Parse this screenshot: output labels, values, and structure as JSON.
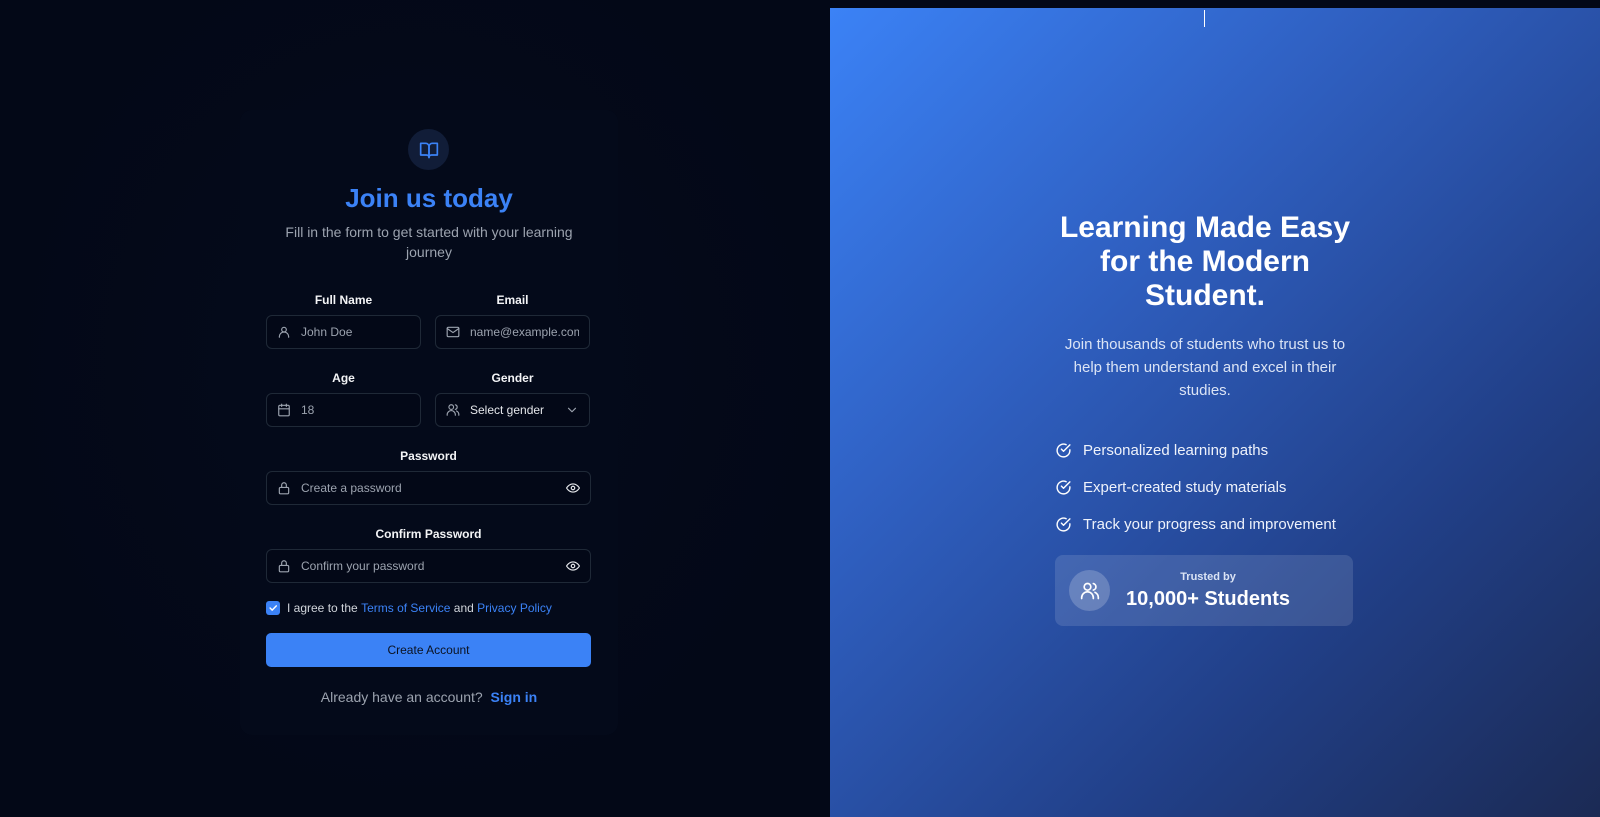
{
  "form": {
    "title": "Join us today",
    "subtitle": "Fill in the form to get started with your learning journey",
    "fields": {
      "full_name": {
        "label": "Full Name",
        "placeholder": "John Doe",
        "icon": "user-icon"
      },
      "email": {
        "label": "Email",
        "placeholder": "name@example.com",
        "icon": "mail-icon"
      },
      "age": {
        "label": "Age",
        "placeholder": "18",
        "icon": "calendar-icon"
      },
      "gender": {
        "label": "Gender",
        "value": "Select gender",
        "icon": "users-icon"
      },
      "password": {
        "label": "Password",
        "placeholder": "Create a password",
        "icon": "lock-icon"
      },
      "confirm_password": {
        "label": "Confirm Password",
        "placeholder": "Confirm your password",
        "icon": "lock-icon"
      }
    },
    "agreement": {
      "checked": true,
      "prefix": "I agree to the",
      "terms": "Terms of Service",
      "conjunction": "and",
      "privacy": "Privacy Policy"
    },
    "submit_label": "Create Account",
    "signin_prompt": "Already have an account?",
    "signin_link": "Sign in"
  },
  "hero": {
    "title": "Learning Made Easy for the Modern Student.",
    "subtitle": "Join thousands of students who trust us to help them understand and excel in their studies.",
    "features": [
      "Personalized learning paths",
      "Expert-created study materials",
      "Track your progress and improvement"
    ],
    "trust": {
      "label": "Trusted by",
      "value": "10,000+ Students"
    }
  },
  "colors": {
    "accent": "#3b82f6",
    "background": "#030817",
    "hero_gradient_start": "#3b82f6",
    "hero_gradient_end": "#1b2a54"
  }
}
